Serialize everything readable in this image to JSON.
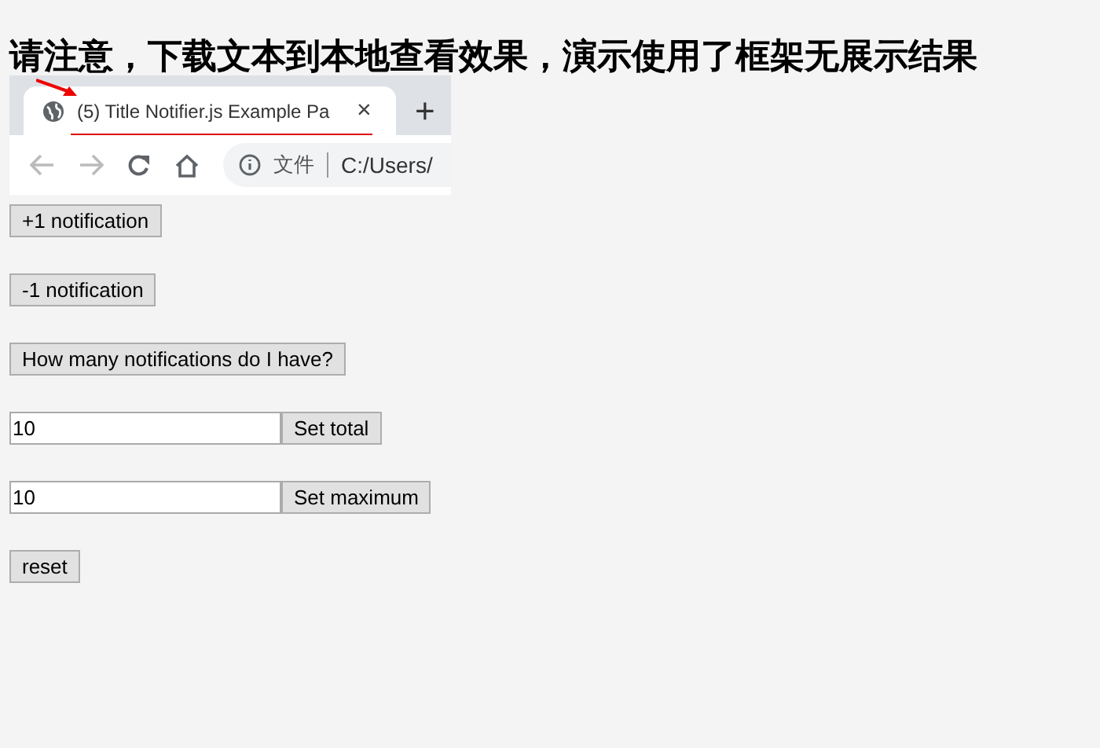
{
  "heading": "请注意，下载文本到本地查看效果，演示使用了框架无展示结果",
  "browser_screenshot": {
    "tab_title": "(5) Title Notifier.js Example Pa",
    "tab_close": "×",
    "new_tab": "+",
    "address_label": "文件",
    "address": "C:/Users/"
  },
  "controls": [
    {
      "kind": "button",
      "label": "+1 notification"
    },
    {
      "kind": "button",
      "label": "-1 notification"
    },
    {
      "kind": "button",
      "label": "How many notifications do I have?"
    },
    {
      "kind": "input",
      "value": "10",
      "button": "Set total"
    },
    {
      "kind": "input",
      "value": "10",
      "button": "Set maximum"
    },
    {
      "kind": "button",
      "label": "reset"
    }
  ]
}
